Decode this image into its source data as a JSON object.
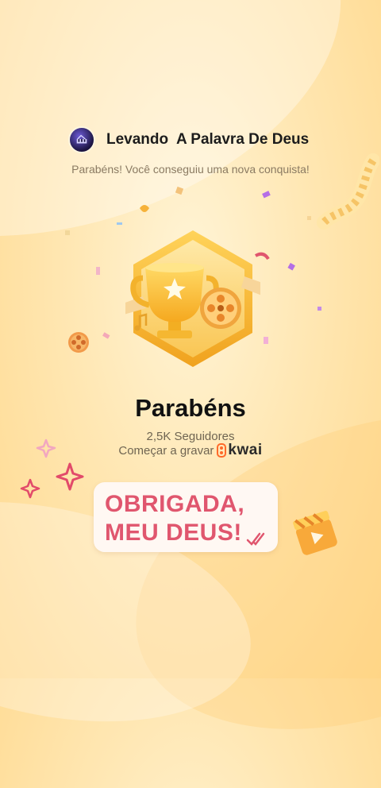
{
  "header": {
    "channel_name": "Levando  A Palavra De Deus"
  },
  "subtitle": "Parabéns! Você conseguiu uma nova conquista!",
  "badge": {
    "icon": "trophy-film-badge"
  },
  "achievement": {
    "title": "Parabéns",
    "followers": "2,5K Seguidores",
    "record_label": "Começar a gravar",
    "brand": "kwai"
  },
  "message": {
    "line1": "OBRIGADA,",
    "line2": "MEU DEUS!"
  },
  "colors": {
    "accent_pink": "#e0566e",
    "gold": "#f5b731",
    "background": "#ffe7b3"
  }
}
